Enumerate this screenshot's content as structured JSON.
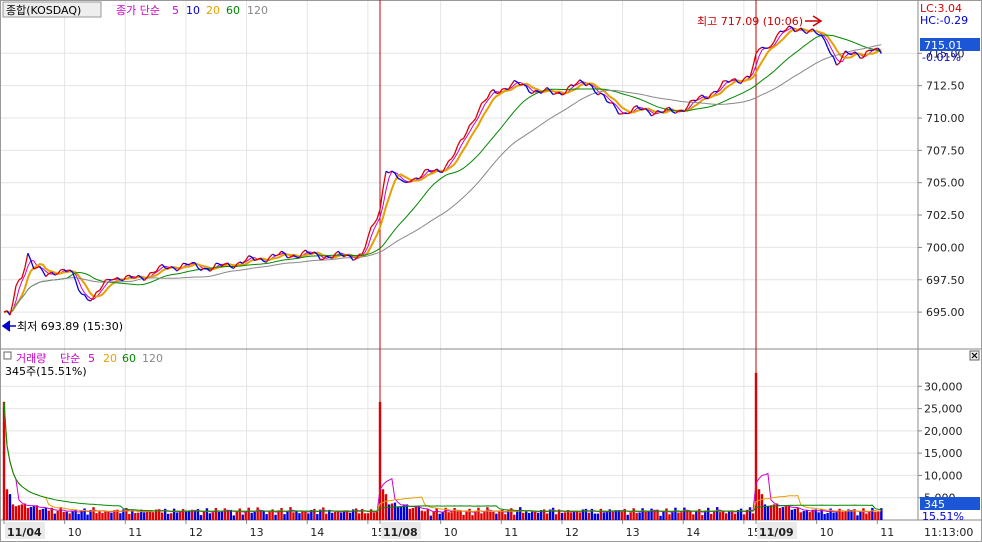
{
  "price_panel": {
    "symbol": "종합(KOSDAQ)",
    "legend_prefix": "종가 단순",
    "ma_labels": [
      "5",
      "10",
      "20",
      "60",
      "120"
    ],
    "ma_colors": [
      "#cc00cc",
      "#0000cc",
      "#e6a000",
      "#008800",
      "#888888"
    ],
    "lc": "LC:3.04",
    "hc": "HC:-0.29",
    "last_price": "715.01",
    "change_pct": "-0.01%",
    "high_note": "최고 717.09 (10:06)",
    "low_note": "최저 693.89 (15:30)"
  },
  "volume_panel": {
    "legend_title": "거래량",
    "legend_prefix": "단순",
    "ma_labels": [
      "5",
      "20",
      "60",
      "120"
    ],
    "ma_colors": [
      "#cc00cc",
      "#e6a000",
      "#008800",
      "#888888"
    ],
    "last_volume_text": "345주(15.51%)",
    "last_volume": "345",
    "last_pct": "15.51%"
  },
  "date_axis": {
    "labels": [
      "11/04",
      "10",
      "11",
      "12",
      "13",
      "14",
      "15",
      "11/08",
      "10",
      "11",
      "12",
      "13",
      "14",
      "15",
      "11/09",
      "10",
      "11"
    ],
    "time_readout": "11:13:00"
  },
  "colors": {
    "up": "#dd0000",
    "down": "#0000dd",
    "separator": "#cc0000",
    "price_box": "#1a56d6"
  },
  "chart_data": [
    {
      "type": "line",
      "title": "",
      "ylim": [
        693.0,
        718.5
      ],
      "y_ticks": [
        695.0,
        697.5,
        700.0,
        702.5,
        705.0,
        707.5,
        710.0,
        712.5,
        715.0
      ],
      "y_tick_labels": [
        "695.00",
        "697.50",
        "700.00",
        "702.50",
        "705.00",
        "707.50",
        "710.00",
        "712.50",
        "715.00"
      ],
      "days": [
        "11/04",
        "11/08",
        "11/09"
      ],
      "series": [
        {
          "name": "종가",
          "x_index": [
            0,
            2,
            4,
            6,
            8,
            10,
            14,
            18,
            22,
            26,
            30,
            36,
            42,
            48,
            55,
            62,
            70,
            80,
            90,
            100,
            110,
            120,
            126,
            128,
            130,
            132,
            134,
            136,
            138,
            140,
            143,
            146,
            149,
            152,
            155,
            158,
            161,
            164,
            168,
            172,
            176,
            180,
            185,
            190,
            196,
            202,
            208,
            214,
            220,
            226,
            232,
            238,
            244,
            250,
            252,
            254,
            256,
            258,
            261,
            264,
            267,
            270,
            273,
            276,
            279,
            282,
            285,
            288,
            291,
            294
          ],
          "values": [
            695.0,
            694.6,
            696.8,
            697.9,
            699.6,
            698.5,
            697.8,
            698.3,
            698.1,
            696.5,
            696.0,
            697.8,
            697.5,
            697.9,
            698.5,
            698.6,
            698.4,
            698.9,
            699.3,
            699.5,
            699.3,
            699.4,
            703.0,
            706.2,
            705.7,
            705.3,
            704.8,
            705.4,
            705.4,
            705.6,
            705.8,
            706.0,
            706.6,
            707.5,
            709.0,
            710.3,
            711.2,
            712.0,
            712.4,
            712.6,
            712.3,
            712.0,
            711.9,
            712.4,
            712.8,
            711.2,
            710.4,
            710.7,
            710.4,
            710.6,
            711.3,
            712.1,
            712.9,
            713.2,
            714.6,
            715.6,
            715.4,
            716.2,
            716.6,
            716.9,
            717.0,
            716.6,
            716.4,
            715.8,
            714.1,
            714.8,
            715.1,
            714.9,
            715.2,
            715.0
          ]
        }
      ]
    },
    {
      "type": "bar",
      "title": "거래량",
      "ylim": [
        0,
        35000
      ],
      "y_ticks": [
        5000,
        10000,
        15000,
        20000,
        25000,
        30000
      ],
      "y_tick_labels": [
        "5,000",
        "10,000",
        "15,000",
        "20,000",
        "25,000",
        "30,000"
      ],
      "spikes": [
        {
          "day": "11/04",
          "value": 26500
        },
        {
          "day": "11/08",
          "value": 26500
        },
        {
          "day": "11/09",
          "value": 33000
        }
      ],
      "last_value": 345
    }
  ]
}
